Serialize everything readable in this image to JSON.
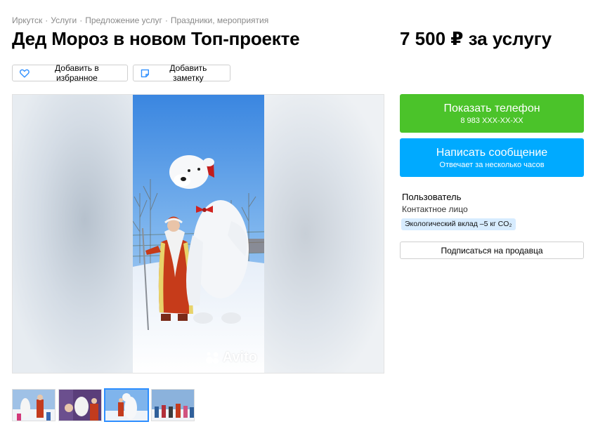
{
  "breadcrumbs": [
    "Иркутск",
    "Услуги",
    "Предложение услуг",
    "Праздники, мероприятия"
  ],
  "breadcrumb_separator": "·",
  "title": "Дед Мороз в новом Топ-проекте",
  "price": "7 500 ₽ за услугу",
  "actions": {
    "favorite_label": "Добавить в избранное",
    "note_label": "Добавить заметку"
  },
  "gallery": {
    "watermark": "Avito",
    "selected_index": 2,
    "thumbnail_count": 4
  },
  "contact": {
    "phone_label": "Показать телефон",
    "phone_masked": "8 983 XXX-XX-XX",
    "message_label": "Написать сообщение",
    "message_sub": "Отвечает за несколько часов"
  },
  "seller": {
    "name": "Пользователь",
    "role": "Контактное лицо",
    "eco_badge": "Экологический вклад –5 кг CO₂",
    "subscribe_label": "Подписаться на продавца"
  },
  "colors": {
    "phone_button": "#4bc32a",
    "message_button": "#00aaff",
    "eco_badge_bg": "#d7ecff",
    "thumb_active": "#2d8eff"
  }
}
